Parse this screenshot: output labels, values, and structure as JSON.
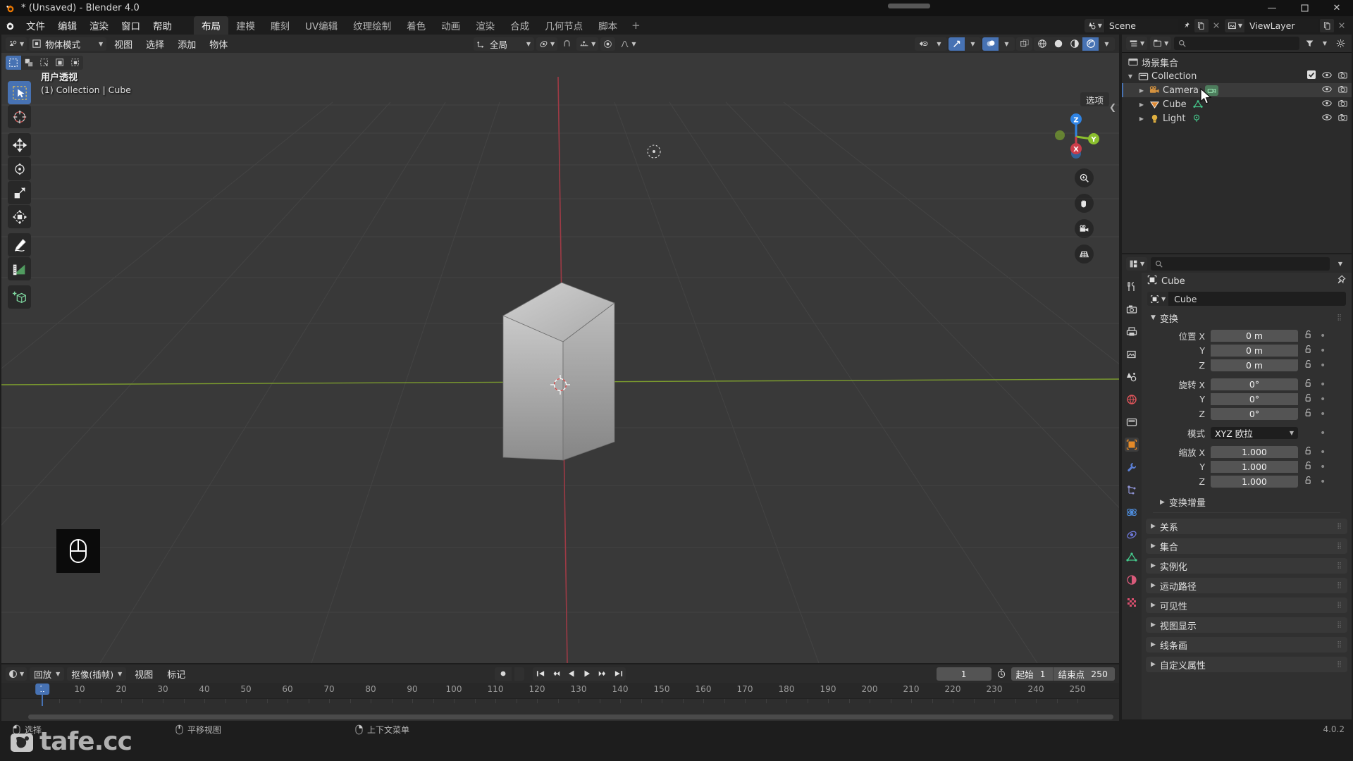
{
  "titlebar": {
    "title": "* (Unsaved) - Blender 4.0",
    "minimize": "—",
    "maximize": "❑",
    "close": "✕"
  },
  "topbar": {
    "menus": [
      "文件",
      "编辑",
      "渲染",
      "窗口",
      "帮助"
    ],
    "workspace_tabs": [
      {
        "label": "布局",
        "active": true
      },
      {
        "label": "建模",
        "active": false
      },
      {
        "label": "雕刻",
        "active": false
      },
      {
        "label": "UV编辑",
        "active": false
      },
      {
        "label": "纹理绘制",
        "active": false
      },
      {
        "label": "着色",
        "active": false
      },
      {
        "label": "动画",
        "active": false
      },
      {
        "label": "渲染",
        "active": false
      },
      {
        "label": "合成",
        "active": false
      },
      {
        "label": "几何节点",
        "active": false
      },
      {
        "label": "脚本",
        "active": false
      }
    ],
    "add_tab": "+",
    "scene_name": "Scene",
    "viewlayer_name": "ViewLayer"
  },
  "viewport": {
    "mode": "物体模式",
    "menus": [
      "视图",
      "选择",
      "添加",
      "物体"
    ],
    "orientation": "全局",
    "options_label": "选项",
    "info_line1": "用户透视",
    "info_line2": "(1) Collection | Cube",
    "gizmo_axes": {
      "x": "X",
      "y": "Y",
      "z": "Z"
    },
    "select_modes": [
      "tweak-select-icon",
      "box-select-icon",
      "circle-select-icon",
      "lasso-select-icon",
      "select-mode-icon"
    ],
    "tools": [
      "tweak-tool-icon",
      "cursor-tool-icon",
      "move-tool-icon",
      "rotate-tool-icon",
      "scale-tool-icon",
      "transform-tool-icon",
      "annotate-tool-icon",
      "measure-tool-icon",
      "add-cube-tool-icon"
    ],
    "nav_buttons": [
      "zoom-icon",
      "pan-hand-icon",
      "camera-view-icon",
      "ortho-persp-icon"
    ]
  },
  "outliner": {
    "search_placeholder": "",
    "root": "场景集合",
    "items": [
      {
        "label": "Collection",
        "icon": "collection-icon",
        "indent": 0,
        "has_checkbox": true,
        "selected": false,
        "datatype": null
      },
      {
        "label": "Camera",
        "icon": "camera-object-icon",
        "indent": 1,
        "has_checkbox": false,
        "selected": true,
        "datatype": "camera-data-icon"
      },
      {
        "label": "Cube",
        "icon": "mesh-object-icon",
        "indent": 1,
        "has_checkbox": false,
        "selected": false,
        "datatype": "mesh-data-icon"
      },
      {
        "label": "Light",
        "icon": "light-object-icon",
        "indent": 1,
        "has_checkbox": false,
        "selected": false,
        "datatype": "light-data-icon"
      }
    ]
  },
  "properties": {
    "search_placeholder": "",
    "breadcrumb_object": "Cube",
    "id_name": "Cube",
    "transform_panel": "变换",
    "fields": {
      "location_label": "位置 X",
      "location": [
        {
          "axis": "位置 X",
          "value": "0 m"
        },
        {
          "axis": "Y",
          "value": "0 m"
        },
        {
          "axis": "Z",
          "value": "0 m"
        }
      ],
      "rotation": [
        {
          "axis": "旋转 X",
          "value": "0°"
        },
        {
          "axis": "Y",
          "value": "0°"
        },
        {
          "axis": "Z",
          "value": "0°"
        }
      ],
      "mode_label": "模式",
      "mode_value": "XYZ 欧拉",
      "scale": [
        {
          "axis": "缩放 X",
          "value": "1.000"
        },
        {
          "axis": "Y",
          "value": "1.000"
        },
        {
          "axis": "Z",
          "value": "1.000"
        }
      ]
    },
    "delta_transform": "变换增量",
    "panels": [
      "关系",
      "集合",
      "实例化",
      "运动路径",
      "可见性",
      "视图显示",
      "线条画",
      "自定义属性"
    ],
    "tabs": [
      "tool-icon",
      "render-icon",
      "output-icon",
      "view-layer-icon",
      "scene-icon",
      "world-icon",
      "collection-properties-icon",
      "object-icon",
      "modifier-icon",
      "particles-icon",
      "physics-icon",
      "constraints-icon",
      "object-data-icon",
      "material-icon",
      "texture-icon"
    ]
  },
  "timeline": {
    "playback_label": "回放",
    "keying_label": "抠像(插帧)",
    "menus": [
      "视图",
      "标记"
    ],
    "current_frame": "1",
    "start_label": "起始",
    "start_value": "1",
    "end_label": "结束点",
    "end_value": "250",
    "ticks": [
      10,
      20,
      30,
      40,
      50,
      60,
      70,
      80,
      90,
      100,
      110,
      120,
      130,
      140,
      150,
      160,
      170,
      180,
      190,
      200,
      210,
      220,
      230,
      240,
      250
    ],
    "playhead_label": "1"
  },
  "statusbar": {
    "items": [
      {
        "icon": "mouse-left-icon",
        "label": "选择"
      },
      {
        "icon": "mouse-middle-icon",
        "label": "平移视图"
      },
      {
        "icon": "mouse-right-icon",
        "label": "上下文菜单"
      }
    ],
    "version": "4.0.2"
  },
  "watermark": {
    "text": "tafe.cc"
  },
  "colors": {
    "accent_blue": "#4772b3",
    "panel_bg": "#303030",
    "header_bg": "#2b2b2b",
    "viewport_bg": "#393939",
    "axis_x_red": "#cc3d4a",
    "axis_y_green": "#8bbf2e",
    "axis_z_blue": "#2f83e3",
    "title_bg": "#121212"
  }
}
